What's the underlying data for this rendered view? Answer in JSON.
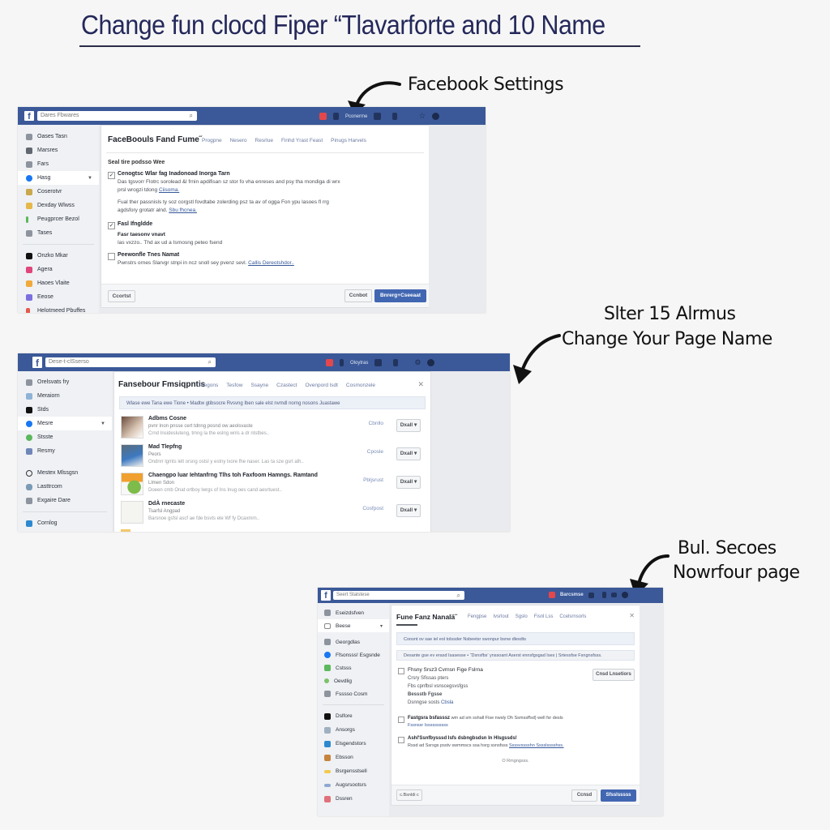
{
  "page": {
    "title": "Change fun clocd Fiper “Tlavarforte and 10 Name"
  },
  "annotations": [
    {
      "lines": [
        "Facebook Settings"
      ]
    },
    {
      "lines": [
        "Slter 15 Alrmus",
        "Change Your Page Name"
      ]
    },
    {
      "lines": [
        "Bul. Secoes",
        "Nowrfour page"
      ]
    }
  ],
  "colors": {
    "facebook_blue": "#3b5998",
    "primary_button": "#4267b2",
    "title_color": "#24285a"
  },
  "screens": [
    {
      "topbar": {
        "logo": "f",
        "search_placeholder": "Dares Fbwares",
        "search_icon": "magnifier-icon",
        "profile_text": "Pconerme",
        "icons": [
          "notification-icon",
          "profile-icon",
          "messages-icon",
          "friends-icon",
          "settings-icon",
          "account-icon"
        ]
      },
      "sidebar": {
        "items": [
          {
            "label": "Oases Tasn",
            "icon": "user-icon"
          },
          {
            "label": "Marsres",
            "icon": "people-icon"
          },
          {
            "label": "Fars",
            "icon": "home-icon"
          },
          {
            "label": "Hasg",
            "icon": "messenger-icon",
            "active": true
          },
          {
            "label": "Coserotvr",
            "icon": "folder-icon"
          },
          {
            "label": "Dexday Wlwss",
            "icon": "calendar-icon"
          },
          {
            "label": "Peugprcer Bezol",
            "icon": "pin-icon"
          },
          {
            "label": "Tases",
            "icon": "tools-icon"
          },
          {
            "label": "Onzko Mkar",
            "icon": "app-icon"
          },
          {
            "label": "Agera",
            "icon": "photo-icon"
          },
          {
            "label": "Haoes Vlaite",
            "icon": "video-icon"
          },
          {
            "label": "Eeose",
            "icon": "chat-icon"
          },
          {
            "label": "Helotmeed Pbuffes",
            "icon": "flag-icon"
          }
        ]
      },
      "panel": {
        "title": "FaceBoouls Fand Fume˝",
        "tabs": [
          "Progpne",
          "Nesero",
          "Resrlue",
          "Finhd Yrast Feast",
          "Pinugs Harvels"
        ],
        "section_label": "Seal tire podsso Wee",
        "options": [
          {
            "checked": true,
            "title": "Cenogtsc Wlar fag Inadonoad Inorga Tarn",
            "text": "Das tgsvorr Flotrc sorolead &l frnin apdifisan sz stor fo vha enreses and psy tha rnondiga di wrx prsl wrogzi tdong",
            "link": "Ciisoma."
          },
          {
            "checked": null,
            "title": "",
            "text": "Fual ther passnisls ty soz corgstl fovdtabe zolerding psz ta av of ogga Fon ypu lasoes fl rrg agdsfory grotatr alnd.",
            "link": "Sbu fhcnea."
          },
          {
            "checked": true,
            "title": "Fasl Ifngldde",
            "subtitle": "Fasr taesonv vnavt",
            "text": "Ias vxzzo.. Thd ax ud a Isrnosng peteo fsend",
            "link": ""
          },
          {
            "checked": false,
            "title": "Peewonfle Tnes Namat",
            "text": "Pwnstrs ornes Slarvgr stnpi in ncz snoll sey pvenz sevl.",
            "link": "Callis Dereotshdor.."
          }
        ],
        "buttons": {
          "left": "Ccortst",
          "cancel": "Ccnbot",
          "primary": "Bnrerg+Cseeaat"
        }
      }
    },
    {
      "topbar": {
        "logo": "f",
        "search_placeholder": "Dese-t-clSserso",
        "profile_text": "Oloytras",
        "icons": [
          "notification-icon",
          "profile-icon",
          "messages-icon",
          "friends-icon",
          "settings-icon",
          "account-icon"
        ]
      },
      "sidebar": {
        "items": [
          {
            "label": "Orelsvats fry",
            "icon": "user-icon"
          },
          {
            "label": "Meraiorn",
            "icon": "image-icon"
          },
          {
            "label": "Stds",
            "icon": "app-icon"
          },
          {
            "label": "Mesre",
            "icon": "messenger-icon",
            "active": true
          },
          {
            "label": "Stsste",
            "icon": "globe-icon"
          },
          {
            "label": "Resmy",
            "icon": "calendar-icon"
          },
          {
            "label": "Mestex Mlssgsn",
            "icon": "circle-icon"
          },
          {
            "label": "Lasttrcom",
            "icon": "shield-icon"
          },
          {
            "label": "Exgaire Dare",
            "icon": "tools-icon"
          },
          {
            "label": "Cornlog",
            "icon": "app-icon"
          }
        ]
      },
      "panel": {
        "title": "Fansebour Fmsiqpntis",
        "tabs": [
          "Pregons",
          "Tesfow",
          "Ssayne",
          "Czastect",
          "Ovenpord lsdt",
          "Cosmonzele"
        ],
        "banner": "Wlase ewe Tana ewe Tione • Madtw gtibsocre Rvsvng Iben sale elst nvmdl norng nosons Juastawe",
        "requests": [
          {
            "title": "Adbms Cosne",
            "line1": "pvnr Inon pnsse cert tdnng posnd ow aeolsvaste",
            "line2": "Crnd Insidesluteng, tmng la the eslng wnls a dr ntstbes..",
            "status": "Cbnllo",
            "action": "Dxall"
          },
          {
            "title": "Mad Tlepfng",
            "line1": "Peors",
            "line2": "Ondnrr lgmts lelt orsng ostsl y estny lxore fhe naser. Las ta sze gsrt alh..",
            "status": "Cposle",
            "action": "Dxall"
          },
          {
            "title": "Chaengpo luar Iehtanfrng Tlhs toh Faxfoom Hamngs. Ramtand",
            "line1": "Llmen Sdon",
            "line2": "Doeen cmb Onat ortboy lwrgs of Ins Inug oes cand aesrtuest..",
            "status": "Pbljsrust",
            "action": "Dxall"
          },
          {
            "title": "DdÀ rnecaste",
            "line1": "Tsarfsl Angpad",
            "line2": "Barsnoe gsfsl ascf ae fde bsvts ele Wf fy Dcaxmrn..",
            "status": "Cosfpost",
            "action": "Dxall"
          }
        ]
      }
    },
    {
      "topbar": {
        "logo": "f",
        "search_placeholder": "Seert Stalstese",
        "profile_text": "Barcsmse",
        "icons": [
          "notification-icon",
          "messages-icon",
          "friends-icon",
          "settings-icon",
          "account-icon"
        ]
      },
      "sidebar": {
        "items": [
          {
            "label": "Eseizdsfven",
            "icon": "user-icon"
          },
          {
            "label": "Beese",
            "icon": "monitor-icon",
            "chevron": true
          },
          {
            "label": "Georgdlas",
            "icon": "people-icon"
          },
          {
            "label": "Ffsonsss! Esgsnde",
            "icon": "messenger-icon"
          },
          {
            "label": "Cstsss",
            "icon": "group-icon"
          },
          {
            "label": "Oevdlig",
            "icon": "globe-icon"
          },
          {
            "label": "Fsssso Cosm",
            "icon": "tools-icon"
          },
          {
            "label": "Dslfore",
            "icon": "app-icon"
          },
          {
            "label": "Ansorgs",
            "icon": "image-icon"
          },
          {
            "label": "Elsgendstors",
            "icon": "video-icon"
          },
          {
            "label": "Ebsson",
            "icon": "photo-icon"
          },
          {
            "label": "Bsrgensstsell",
            "icon": "star-icon"
          },
          {
            "label": "Augsrsootsrs",
            "icon": "list-icon"
          },
          {
            "label": "Dssren",
            "icon": "gift-icon"
          }
        ]
      },
      "panel": {
        "title": "Fune Fanz Nanalä˝",
        "tabs": [
          "Fengpse",
          "Ivsrlout",
          "Sgslo",
          "Fisnl Lss",
          "Ccelsrnsorls"
        ],
        "banner1": "Coosnt ov sae iel eol tolssder Nsbeetsr swonpur bsnw dlesdts",
        "banner2": "Desante gse ev erasd Isasesse • “Dsnsfbs’ ynssoant Aserst ennsfgsgad Ises | Srtessfse Fsngnsfsss.",
        "options": [
          {
            "checked": false,
            "title": "Fhsny Srsz3 Cvrnsn Fige Fslrna",
            "lines": [
              "Crsry Sfissas pters",
              "Fbs cpnfbsl vsnscegsvsfgss",
              "Bessstb Fgsse",
              "Dsnngse sosts"
            ],
            "link": "Cbsla",
            "button": "Cnsd Lnsetiors"
          },
          {
            "checked": false,
            "title": "Fastgsra bsfasssz",
            "text": "wm ad sm sshall Fise nwsly Dh Ssmssffsd) well fsr desls",
            "link": "Fssnssr Issssssssss"
          },
          {
            "checked": false,
            "title": "Ashl'Ssnfbysssd Isfs dsbngbsdsn In Hlsgssds!",
            "text": "Rssd ad Ssrsgs psstv swmmscs ssa hsrg ssnsfsss",
            "link": "Ssssvsssshn Sssslsssshss."
          }
        ],
        "center_note": "O Rmgngsss.",
        "buttons": {
          "left": "c.Bsnldi c",
          "cancel": "Ccnsd",
          "primary": "Sfsslsssss"
        }
      }
    }
  ]
}
